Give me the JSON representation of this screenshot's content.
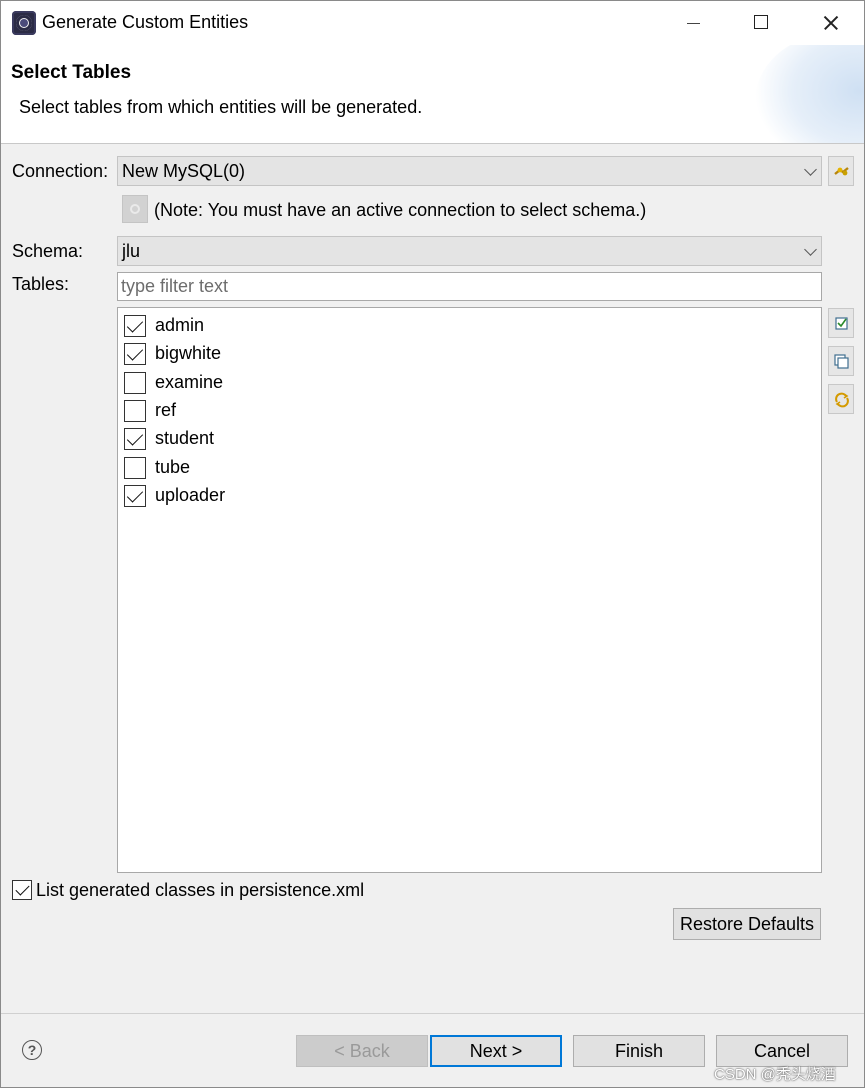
{
  "window": {
    "title": "Generate Custom Entities"
  },
  "header": {
    "title": "Select Tables",
    "description": "Select tables from which entities will be generated."
  },
  "connection": {
    "label": "Connection:",
    "value": "New MySQL(0)",
    "note": "(Note: You must have an active connection to select schema.)"
  },
  "schema": {
    "label": "Schema:",
    "value": "jlu"
  },
  "tables": {
    "label": "Tables:",
    "filter_placeholder": "type filter text",
    "items": [
      {
        "name": "admin",
        "checked": true
      },
      {
        "name": "bigwhite",
        "checked": true
      },
      {
        "name": "examine",
        "checked": false
      },
      {
        "name": "ref",
        "checked": false
      },
      {
        "name": "student",
        "checked": true
      },
      {
        "name": "tube",
        "checked": false
      },
      {
        "name": "uploader",
        "checked": true
      }
    ]
  },
  "options": {
    "persistence_label": "List generated classes in persistence.xml",
    "persistence_checked": true,
    "restore_defaults": "Restore Defaults"
  },
  "footer": {
    "back": "< Back",
    "next": "Next >",
    "finish": "Finish",
    "cancel": "Cancel"
  },
  "watermark": "CSDN @秃头烧酒"
}
